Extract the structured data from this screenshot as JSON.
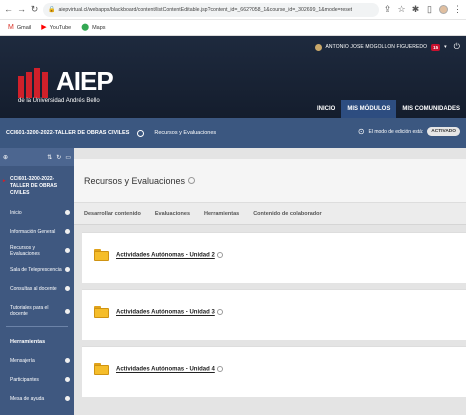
{
  "browser": {
    "url": "aiepvirtual.cl/webapps/blackboard/content/listContentEditable.jsp?content_id=_662?058_1&course_id=_302699_1&mode=reset",
    "bookmarks": [
      {
        "label": "Gmail",
        "icon": "gmail-icon"
      },
      {
        "label": "YouTube",
        "icon": "youtube-icon"
      },
      {
        "label": "Maps",
        "icon": "maps-icon"
      }
    ]
  },
  "header": {
    "user_name": "ANTONIO JOSE MOGOLLON FIGUEREDO",
    "notifications": "15",
    "logo_text": "AIEP",
    "logo_subtitle": "de la Universidad Andrés Bello",
    "nav": [
      "INICIO",
      "MIS MÓDULOS",
      "MIS COMUNIDADES"
    ],
    "active_nav": "MIS MÓDULOS"
  },
  "course_bar": {
    "course": "CCI601-3200-2022-TALLER DE OBRAS CIVILES",
    "breadcrumb": "Recursos y Evaluaciones",
    "edit_mode_label": "El modo de edición está:",
    "edit_mode_state": "ACTIVADO"
  },
  "sidebar": {
    "course_title": "CCI601-3200-2022-TALLER DE OBRAS CIVILES",
    "items": [
      "Inicio",
      "Información General",
      "Recursos y Evaluaciones",
      "Sala de Teleprescencia",
      "Consultas al docente",
      "Tutoriales para el docente"
    ],
    "section_title": "Herramientas",
    "tools": [
      "Mensajería",
      "Participantes",
      "Mesa de ayuda"
    ]
  },
  "content": {
    "title": "Recursos y Evaluaciones",
    "actions": [
      "Desarrollar contenido",
      "Evaluaciones",
      "Herramientas",
      "Contenido de colaborador"
    ],
    "items": [
      "Actividades Autónomas - Unidad 2",
      "Actividades Autónomas - Unidad 3",
      "Actividades Autónomas - Unidad 4"
    ]
  },
  "colors": {
    "header_bg": "#1e2a3e",
    "course_bar": "#3b5780",
    "sidebar": "#3f5880",
    "accent_red": "#d0202a",
    "folder": "#f5bd2a"
  }
}
